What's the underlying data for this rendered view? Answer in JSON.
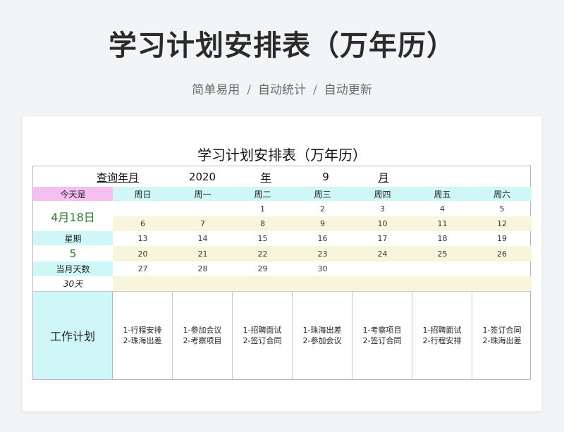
{
  "header": {
    "title": "学习计划安排表（万年历）",
    "subtitle_parts": [
      "简单易用",
      "/",
      "自动统计",
      "/",
      "自动更新"
    ]
  },
  "sheet": {
    "title": "学习计划安排表（万年历）",
    "query": {
      "label": "查询年月",
      "year": "2020",
      "year_unit": "年",
      "month": "9",
      "month_unit": "月"
    },
    "side": {
      "today_label": "今天是",
      "today_value": "4月18日",
      "weekday_label": "星期",
      "weekday_value": "5",
      "days_label": "当月天数",
      "days_value": "30天"
    },
    "weekdays": [
      "周日",
      "周一",
      "周二",
      "周三",
      "周四",
      "周五",
      "周六"
    ],
    "weeks": [
      [
        "",
        "",
        "1",
        "2",
        "3",
        "4",
        "5"
      ],
      [
        "6",
        "7",
        "8",
        "9",
        "10",
        "11",
        "12"
      ],
      [
        "13",
        "14",
        "15",
        "16",
        "17",
        "18",
        "19"
      ],
      [
        "20",
        "21",
        "22",
        "23",
        "24",
        "25",
        "26"
      ],
      [
        "27",
        "28",
        "29",
        "30",
        "",
        "",
        ""
      ],
      [
        "",
        "",
        "",
        "",
        "",
        "",
        ""
      ]
    ],
    "plan_label": "工作计划",
    "plans": [
      [
        "1-行程安排",
        "2-珠海出差"
      ],
      [
        "1-参加会议",
        "2-考察项目"
      ],
      [
        "1-招聘面试",
        "2-签订合同"
      ],
      [
        "1-珠海出差",
        "2-参加会议"
      ],
      [
        "1-考察项目",
        "2-签订合同"
      ],
      [
        "1-招聘面试",
        "2-行程安排"
      ],
      [
        "1-签订合同",
        "2-珠海出差"
      ]
    ]
  },
  "colors": {
    "pink": "#f6bff2",
    "cyan": "#cff7f7",
    "yellow": "#f9f5dc",
    "green_text": "#2a7a2a"
  }
}
